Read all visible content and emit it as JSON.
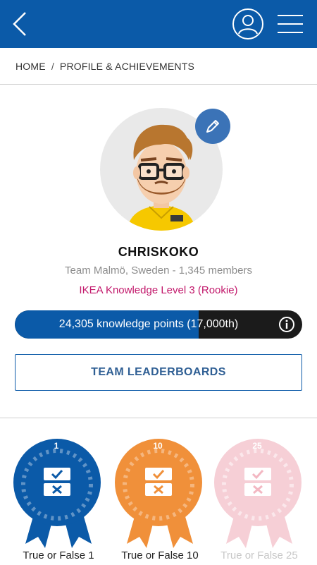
{
  "header": {
    "back_icon": "chevron-left-icon",
    "profile_icon": "user-circle-icon",
    "menu_icon": "hamburger-menu-icon",
    "bg_color": "#0b5aa8"
  },
  "breadcrumb": {
    "home": "HOME",
    "separator": "/",
    "current": "PROFILE & ACHIEVEMENTS"
  },
  "profile": {
    "username": "CHRISKOKO",
    "team": "Team Malmö, Sweden - 1,345 members",
    "level": "IKEA Knowledge Level 3 (Rookie)",
    "level_color": "#c2186b",
    "points_text": "24,305 knowledge points (17,000th)",
    "points_progress": 0.64,
    "edit_icon": "pencil-icon",
    "info_icon": "info-icon"
  },
  "leaderboard_button": "TEAM LEADERBOARDS",
  "badges": [
    {
      "number": "1",
      "label": "True or False 1",
      "color": "#0b5aa8",
      "locked": false
    },
    {
      "number": "10",
      "label": "True or False 10",
      "color": "#f0903a",
      "locked": false
    },
    {
      "number": "25",
      "label": "True or False 25",
      "color": "#f6cfd6",
      "locked": true
    }
  ]
}
